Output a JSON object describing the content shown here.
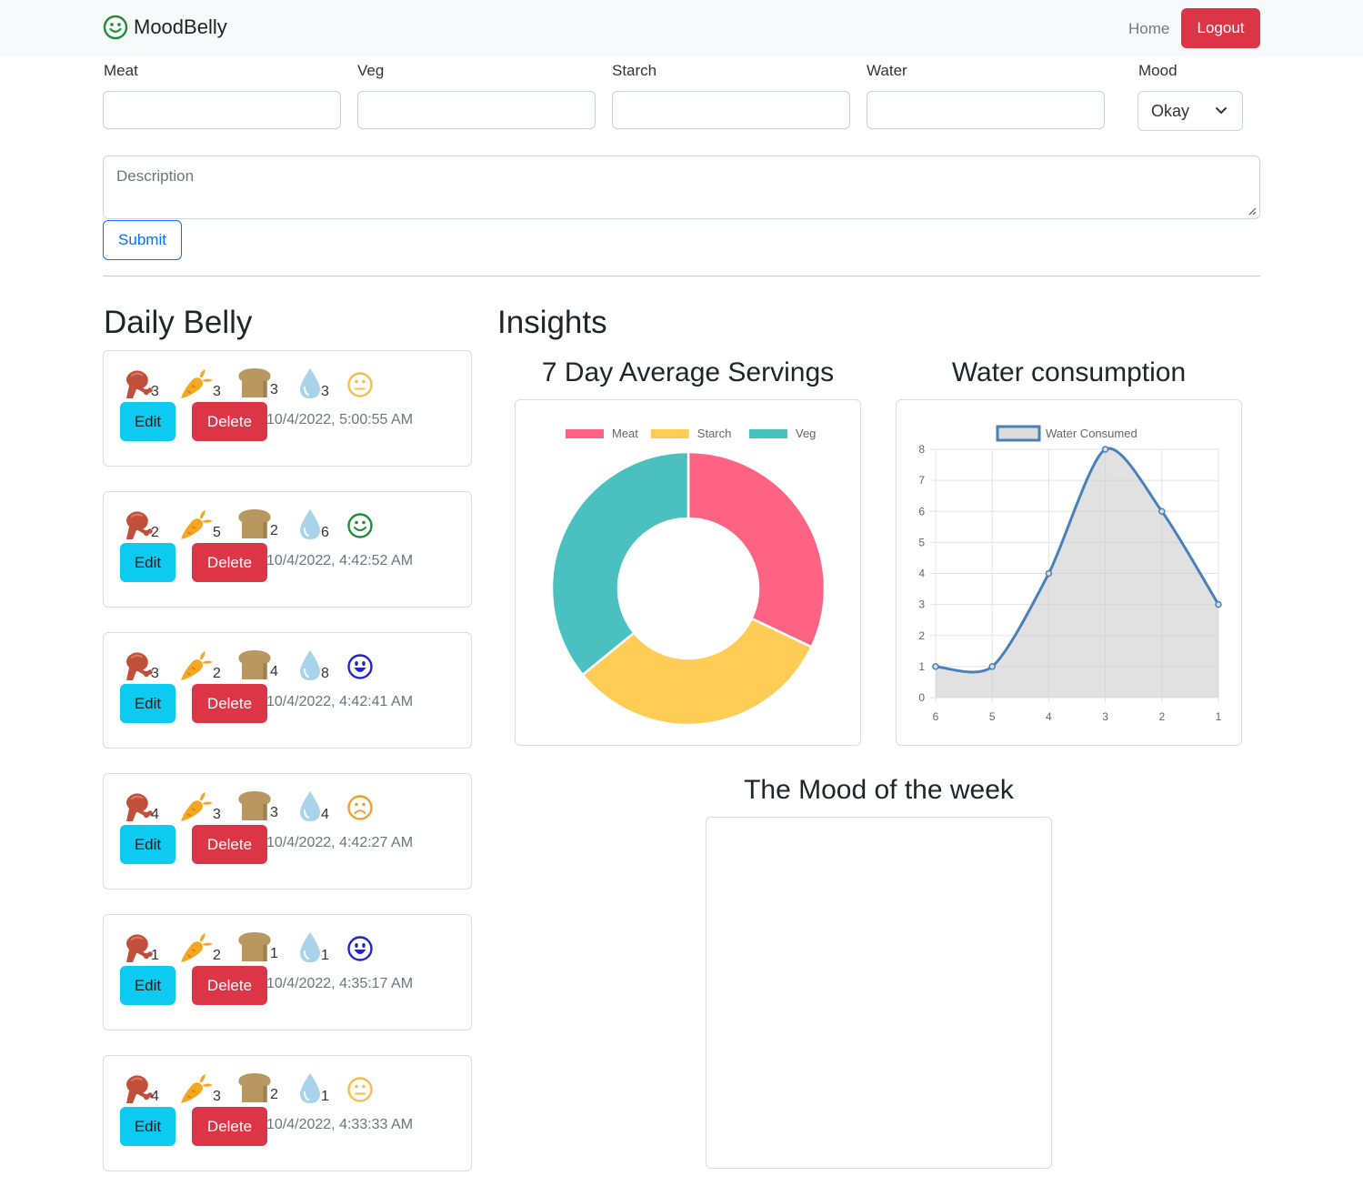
{
  "nav": {
    "brand": "MoodBelly",
    "home_label": "Home",
    "logout_label": "Logout"
  },
  "form": {
    "meat_label": "Meat",
    "veg_label": "Veg",
    "starch_label": "Starch",
    "water_label": "Water",
    "mood_label": "Mood",
    "mood_value": "Okay",
    "description_placeholder": "Description",
    "submit_label": "Submit"
  },
  "daily": {
    "title": "Daily Belly",
    "edit_label": "Edit",
    "delete_label": "Delete",
    "entries": [
      {
        "meat": "3",
        "veg": "3",
        "starch": "3",
        "water": "3",
        "mood": "neutral",
        "time": "10/4/2022, 5:00:55 AM"
      },
      {
        "meat": "2",
        "veg": "5",
        "starch": "2",
        "water": "6",
        "mood": "happy",
        "time": "10/4/2022, 4:42:52 AM"
      },
      {
        "meat": "3",
        "veg": "2",
        "starch": "4",
        "water": "8",
        "mood": "very-happy",
        "time": "10/4/2022, 4:42:41 AM"
      },
      {
        "meat": "4",
        "veg": "3",
        "starch": "3",
        "water": "4",
        "mood": "sad",
        "time": "10/4/2022, 4:42:27 AM"
      },
      {
        "meat": "1",
        "veg": "2",
        "starch": "1",
        "water": "1",
        "mood": "very-happy",
        "time": "10/4/2022, 4:35:17 AM"
      },
      {
        "meat": "4",
        "veg": "3",
        "starch": "2",
        "water": "1",
        "mood": "neutral",
        "time": "10/4/2022, 4:33:33 AM"
      }
    ]
  },
  "insights": {
    "title": "Insights",
    "servings_title": "7 Day Average Servings",
    "water_title": "Water consumption",
    "mood_title": "The Mood of the week"
  },
  "icons": {
    "meat": "drumstick-icon",
    "veg": "carrot-icon",
    "starch": "bread-icon",
    "water": "water-drop-icon"
  },
  "colors": {
    "meat": "#ff6384",
    "starch": "#ffcd56",
    "veg": "#4bc0c0",
    "water_line": "#4a80b8",
    "danger": "#dc3545",
    "info": "#0dcaf0",
    "primary": "#0d6efd",
    "mood_neutral": "#f5c04a",
    "mood_happy": "#1f8f3a",
    "mood_very_happy": "#2324c9",
    "mood_sad": "#f0a030"
  },
  "chart_data": [
    {
      "type": "pie",
      "title": "7 Day Average Servings",
      "categories": [
        "Meat",
        "Starch",
        "Veg"
      ],
      "values": [
        2.83,
        2.83,
        3.17
      ],
      "colors": [
        "#ff6384",
        "#ffcd56",
        "#4bc0c0"
      ],
      "legend": "top",
      "donut": true
    },
    {
      "type": "area",
      "title": "Water consumption",
      "x": [
        "6",
        "5",
        "4",
        "3",
        "2",
        "1"
      ],
      "series": [
        {
          "name": "Water Consumed",
          "values": [
            1,
            1,
            4,
            8,
            6,
            3
          ]
        }
      ],
      "ylim": [
        0,
        8
      ],
      "yticks": [
        0,
        1,
        2,
        3,
        4,
        5,
        6,
        7,
        8
      ],
      "grid": true,
      "legend": "top"
    }
  ]
}
